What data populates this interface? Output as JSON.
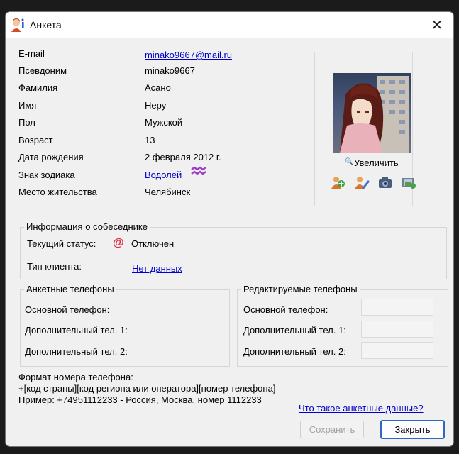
{
  "window": {
    "title": "Анкета",
    "close_glyph": "✕"
  },
  "profile": [
    {
      "label": "E-mail",
      "value": "minako9667@mail.ru",
      "link": true
    },
    {
      "label": "Псевдоним",
      "value": "minako9667"
    },
    {
      "label": "Фамилия",
      "value": "Асано"
    },
    {
      "label": "Имя",
      "value": "Нeру"
    },
    {
      "label": "Пол",
      "value": "Мужской"
    },
    {
      "label": "Возраст",
      "value": "13"
    },
    {
      "label": "Дата рождения",
      "value": "2 февраля 2012 г."
    },
    {
      "label": "Знак зодиака",
      "value": "Водолей",
      "link": true
    },
    {
      "label": "Место жительства",
      "value": "Челябинск"
    }
  ],
  "photo": {
    "enlarge_label": "Увеличить",
    "zoom_glyph": "🔍"
  },
  "interlocutor": {
    "title": "Информация о собеседнике",
    "status_label": "Текущий статус:",
    "status_value": "Отключен",
    "client_label": "Тип клиента:",
    "client_value": "Нет данных"
  },
  "profile_phones": {
    "title": "Анкетные телефоны",
    "main": "Основной телефон:",
    "extra1": "Дополнительный тел. 1:",
    "extra2": "Дополнительный тел. 2:"
  },
  "editable_phones": {
    "title": "Редактируемые телефоны",
    "main": "Основной телефон:",
    "extra1": "Дополнительный тел. 1:",
    "extra2": "Дополнительный тел. 2:"
  },
  "format_note": {
    "line1": "Формат номера телефона:",
    "line2": "+[код страны][код региона или оператора][номер телефона]",
    "line3": "Пример: +74951112233 - Россия, Москва, номер 1112233"
  },
  "help_link": "Что такое анкетные данные?",
  "buttons": {
    "save": "Сохранить",
    "close": "Закрыть"
  },
  "colors": {
    "link": "#0000cc",
    "accent": "#2f67c7",
    "status_icon": "#e0263a"
  }
}
